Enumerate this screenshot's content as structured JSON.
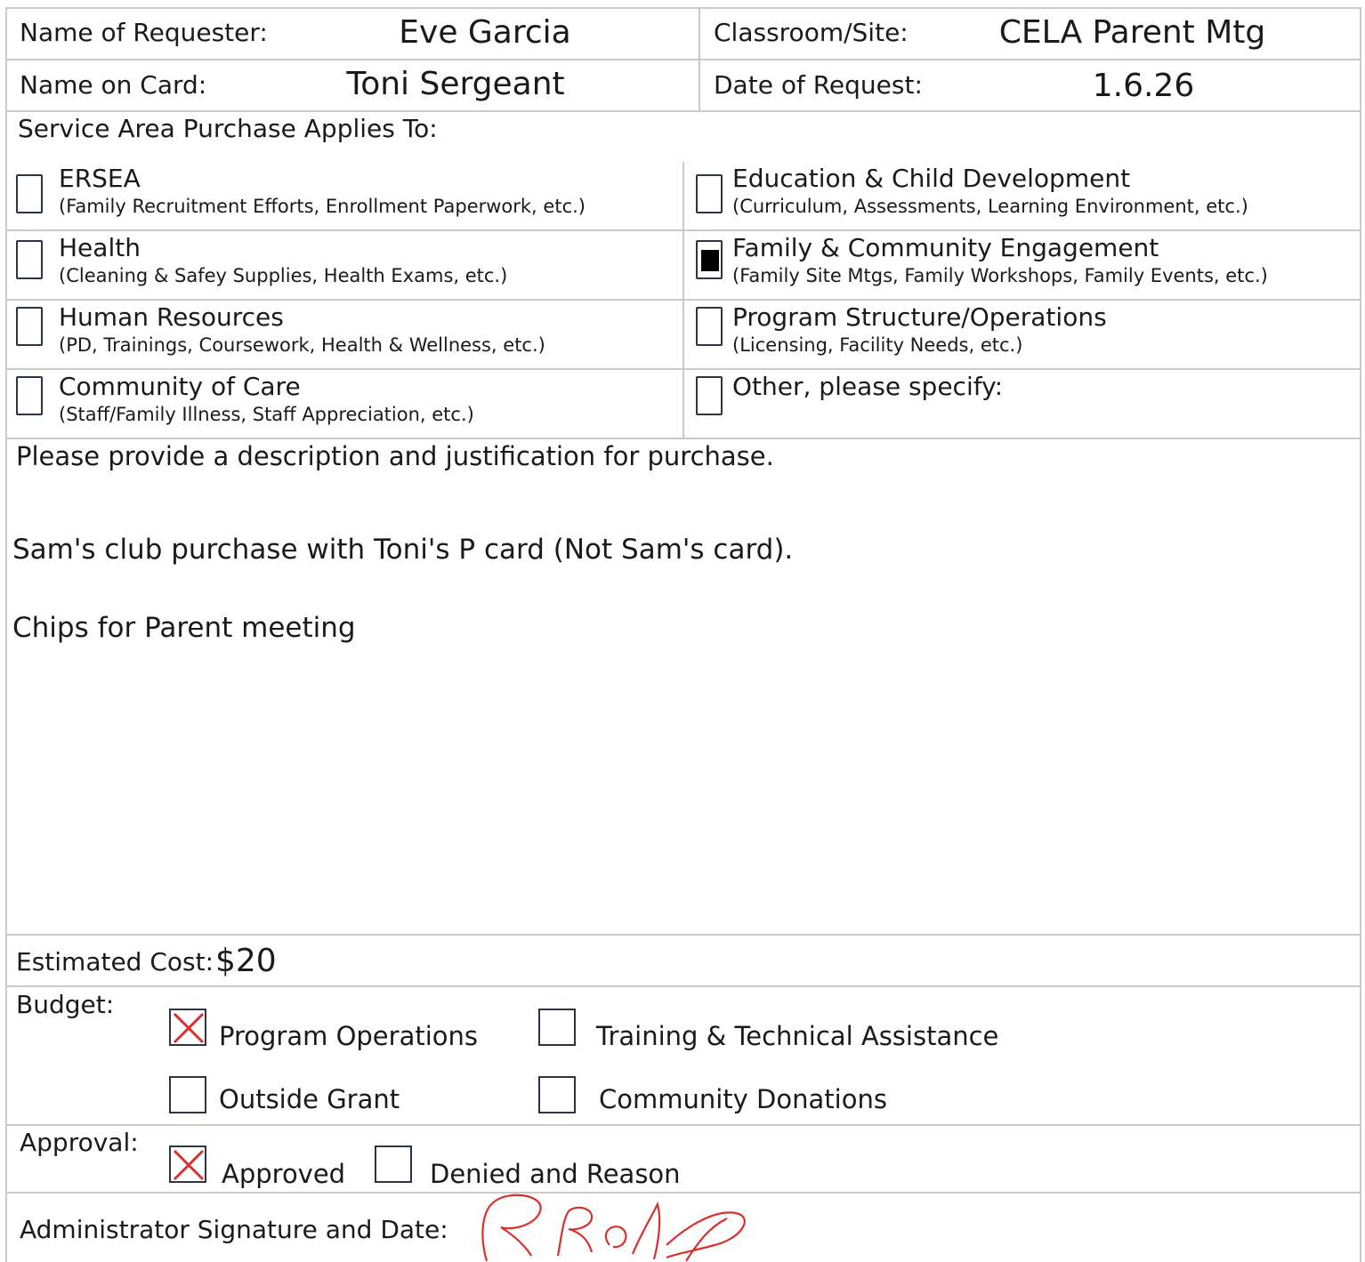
{
  "header": {
    "requester_label": "Name of Requester:",
    "requester_value": "Eve Garcia",
    "site_label": "Classroom/Site:",
    "site_value": "CELA Parent Mtg",
    "card_label": "Name on Card:",
    "card_value": "Toni Sergeant",
    "date_label": "Date of Request:",
    "date_value": "1.6.26"
  },
  "service_area": {
    "heading": "Service Area Purchase Applies To:",
    "options": [
      {
        "title": "ERSEA",
        "sub": "(Family Recruitment Efforts, Enrollment Paperwork, etc.)",
        "checked": false
      },
      {
        "title": "Education & Child Development",
        "sub": "(Curriculum, Assessments, Learning Environment, etc.)",
        "checked": false
      },
      {
        "title": "Health",
        "sub": "(Cleaning & Safey Supplies, Health Exams, etc.)",
        "checked": false
      },
      {
        "title": "Family & Community Engagement",
        "sub": "(Family Site Mtgs, Family Workshops, Family Events, etc.)",
        "checked": true
      },
      {
        "title": "Human Resources",
        "sub": "(PD, Trainings, Coursework, Health & Wellness, etc.)",
        "checked": false
      },
      {
        "title": "Program Structure/Operations",
        "sub": "(Licensing, Facility Needs, etc.)",
        "checked": false
      },
      {
        "title": "Community of Care",
        "sub": "(Staff/Family Illness, Staff Appreciation, etc.)",
        "checked": false
      },
      {
        "title": "Other, please specify:",
        "sub": "",
        "checked": false
      }
    ]
  },
  "description": {
    "prompt": "Please provide a description and justification for purchase.",
    "line1": "Sam's club purchase with Toni's P card (Not Sam's card).",
    "line2": "Chips for Parent meeting"
  },
  "cost": {
    "label": "Estimated Cost:",
    "value": "$20"
  },
  "budget": {
    "label": "Budget:",
    "options": [
      {
        "label": "Program Operations",
        "checked": true
      },
      {
        "label": "Training & Technical Assistance",
        "checked": false
      },
      {
        "label": "Outside Grant",
        "checked": false
      },
      {
        "label": "Community Donations",
        "checked": false
      }
    ]
  },
  "approval": {
    "label": "Approval:",
    "approved_label": "Approved",
    "approved_checked": true,
    "denied_label": "Denied and Reason",
    "denied_checked": false
  },
  "signature": {
    "label": "Administrator Signature and Date:",
    "ink_color": "#d8312b"
  },
  "colors": {
    "check_mark": "#d8312b",
    "grid_line": "#c9c9c9",
    "box_border": "#2b3445"
  }
}
